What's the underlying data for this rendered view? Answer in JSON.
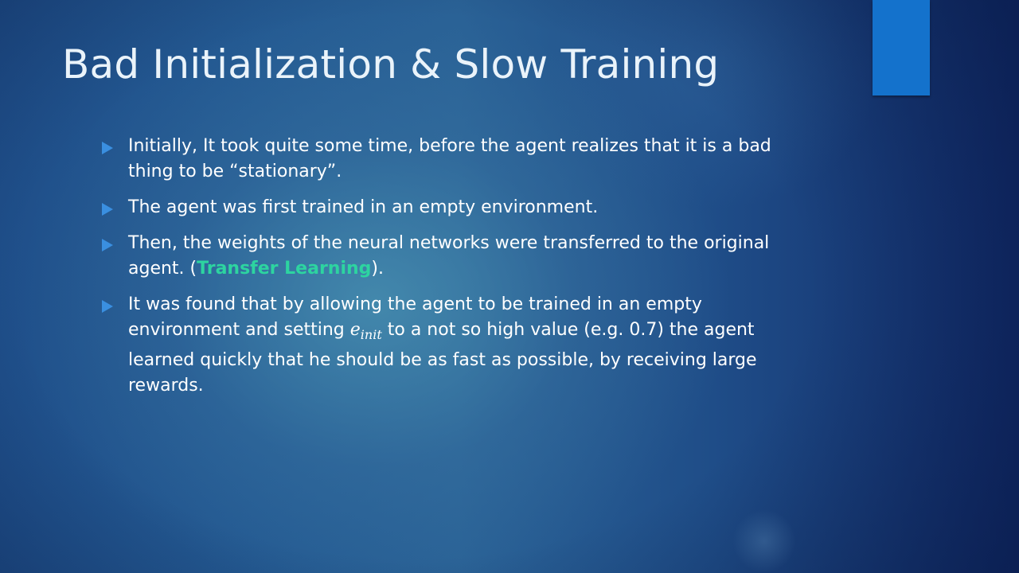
{
  "slide": {
    "title": "Bad Initialization & Slow Training",
    "accent_color": "#1472cc",
    "highlight_color": "#2dd4a0",
    "bullet_icon": "triangle-right-icon",
    "bullets": [
      {
        "text": "Initially, It took quite some time, before the agent realizes that it is a bad thing to be “stationary”."
      },
      {
        "text": "The agent was first trained in an empty environment."
      },
      {
        "before": "Then, the weights of the neural networks were transferred to the original agent. (",
        "highlight": "Transfer Learning",
        "after": ")."
      },
      {
        "before": "It was found that by allowing the agent to be trained in an empty environment and setting ",
        "math_base": "e",
        "math_sub": "init",
        "after": " to a not so high value (e.g. 0.7) the agent learned quickly that he should be as fast as possible, by receiving large rewards."
      }
    ]
  }
}
